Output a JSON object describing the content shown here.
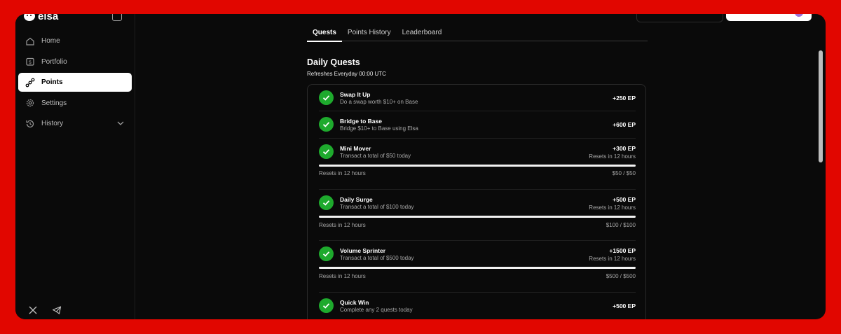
{
  "brand": {
    "name": "elsa"
  },
  "sidebar": {
    "items": [
      {
        "label": "Home",
        "icon": "home-icon"
      },
      {
        "label": "Portfolio",
        "icon": "wallet-icon"
      },
      {
        "label": "Points",
        "icon": "points-icon",
        "active": true
      },
      {
        "label": "Settings",
        "icon": "gear-icon"
      },
      {
        "label": "History",
        "icon": "history-icon"
      }
    ]
  },
  "tabs": [
    {
      "label": "Quests",
      "active": true
    },
    {
      "label": "Points History"
    },
    {
      "label": "Leaderboard"
    }
  ],
  "daily": {
    "title": "Daily Quests",
    "subtitle": "Refreshes Everyday 00:00 UTC"
  },
  "quests": [
    {
      "name": "Swap It Up",
      "desc": "Do a swap worth $10+ on Base",
      "reward": "+250 EP"
    },
    {
      "name": "Bridge to Base",
      "desc": "Bridge $10+ to Base using Elsa",
      "reward": "+600 EP"
    },
    {
      "name": "Mini Mover",
      "desc": "Transact a total of $50 today",
      "reward": "+300 EP",
      "reset": "Resets in 12 hours",
      "progress_left": "Resets in 12 hours",
      "progress_right": "$50 / $50",
      "progress": 1.0
    },
    {
      "name": "Daily Surge",
      "desc": "Transact a total of $100 today",
      "reward": "+500 EP",
      "reset": "Resets in 12 hours",
      "progress_left": "Resets in 12 hours",
      "progress_right": "$100 / $100",
      "progress": 1.0
    },
    {
      "name": "Volume Sprinter",
      "desc": "Transact a total of $500 today",
      "reward": "+1500 EP",
      "reset": "Resets in 12 hours",
      "progress_left": "Resets in 12 hours",
      "progress_right": "$500 / $500",
      "progress": 1.0
    },
    {
      "name": "Quick Win",
      "desc": "Complete any 2 quests today",
      "reward": "+500 EP"
    }
  ],
  "colors": {
    "accent": "#e10600",
    "check": "#1eaa2d",
    "background": "#0a0a0a"
  }
}
